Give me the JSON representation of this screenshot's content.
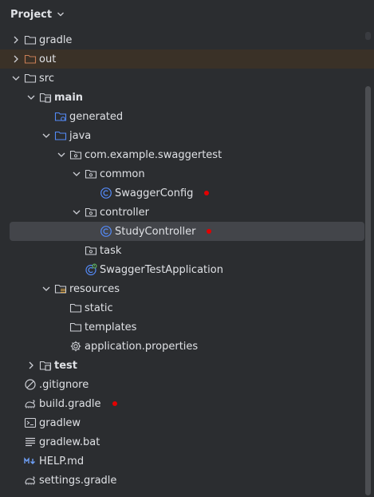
{
  "header": {
    "title": "Project"
  },
  "tree": [
    {
      "key": "gradle",
      "label": "gradle",
      "depth": 1,
      "arrow": "collapsed",
      "icon": "folder-icon",
      "style": "normal"
    },
    {
      "key": "out",
      "label": "out",
      "depth": 1,
      "arrow": "collapsed",
      "icon": "folder-orange-icon",
      "style": "excluded"
    },
    {
      "key": "src",
      "label": "src",
      "depth": 1,
      "arrow": "expanded",
      "icon": "folder-icon",
      "style": "normal"
    },
    {
      "key": "main",
      "label": "main",
      "depth": 2,
      "arrow": "expanded",
      "icon": "module-folder-icon",
      "style": "bold"
    },
    {
      "key": "generated",
      "label": "generated",
      "depth": 3,
      "arrow": "none",
      "icon": "generated-source-folder-icon",
      "style": "normal"
    },
    {
      "key": "java",
      "label": "java",
      "depth": 3,
      "arrow": "expanded",
      "icon": "source-folder-icon",
      "style": "normal"
    },
    {
      "key": "package",
      "label": "com.example.swaggertest",
      "depth": 4,
      "arrow": "expanded",
      "icon": "package-icon",
      "style": "normal"
    },
    {
      "key": "common",
      "label": "common",
      "depth": 5,
      "arrow": "expanded",
      "icon": "package-icon",
      "style": "normal"
    },
    {
      "key": "swaggerconfig",
      "label": "SwaggerConfig",
      "depth": 6,
      "arrow": "none",
      "icon": "class-icon",
      "style": "normal",
      "marker": true
    },
    {
      "key": "controller",
      "label": "controller",
      "depth": 5,
      "arrow": "expanded",
      "icon": "package-icon",
      "style": "normal"
    },
    {
      "key": "studycontroller",
      "label": "StudyController",
      "depth": 6,
      "arrow": "none",
      "icon": "class-icon",
      "style": "selected",
      "marker": true
    },
    {
      "key": "task",
      "label": "task",
      "depth": 5,
      "arrow": "none",
      "icon": "package-icon",
      "style": "normal"
    },
    {
      "key": "swaggertestapplication",
      "label": "SwaggerTestApplication",
      "depth": 5,
      "arrow": "none",
      "icon": "spring-boot-class-icon",
      "style": "normal"
    },
    {
      "key": "resources",
      "label": "resources",
      "depth": 3,
      "arrow": "expanded",
      "icon": "resources-folder-icon",
      "style": "normal"
    },
    {
      "key": "static",
      "label": "static",
      "depth": 4,
      "arrow": "none",
      "icon": "folder-icon",
      "style": "normal"
    },
    {
      "key": "templates",
      "label": "templates",
      "depth": 4,
      "arrow": "none",
      "icon": "folder-icon",
      "style": "normal"
    },
    {
      "key": "appprops",
      "label": "application.properties",
      "depth": 4,
      "arrow": "none",
      "icon": "settings-gear-icon",
      "style": "normal"
    },
    {
      "key": "test",
      "label": "test",
      "depth": 2,
      "arrow": "collapsed",
      "icon": "module-folder-icon",
      "style": "bold"
    },
    {
      "key": "gitignore",
      "label": ".gitignore",
      "depth": 1,
      "arrow": "none",
      "icon": "ignore-icon",
      "style": "normal"
    },
    {
      "key": "buildgradle",
      "label": "build.gradle",
      "depth": 1,
      "arrow": "none",
      "icon": "gradle-elephant-icon",
      "style": "normal",
      "marker": true
    },
    {
      "key": "gradlew",
      "label": "gradlew",
      "depth": 1,
      "arrow": "none",
      "icon": "terminal-icon",
      "style": "normal"
    },
    {
      "key": "gradlewbat",
      "label": "gradlew.bat",
      "depth": 1,
      "arrow": "none",
      "icon": "text-lines-icon",
      "style": "normal"
    },
    {
      "key": "helpmd",
      "label": "HELP.md",
      "depth": 1,
      "arrow": "none",
      "icon": "markdown-icon",
      "style": "normal"
    },
    {
      "key": "settingsgradle",
      "label": "settings.gradle",
      "depth": 1,
      "arrow": "none",
      "icon": "gradle-elephant-icon",
      "style": "normal"
    }
  ],
  "colors": {
    "marker": "#e30000",
    "selection": "#43454a",
    "excluded_row": "#3a3127",
    "folder_stroke": "#ced0d6",
    "excluded_folder": "#c77d55",
    "source_folder": "#548af7",
    "class_icon": "#548af7",
    "spring_icon": "#5fb865"
  }
}
